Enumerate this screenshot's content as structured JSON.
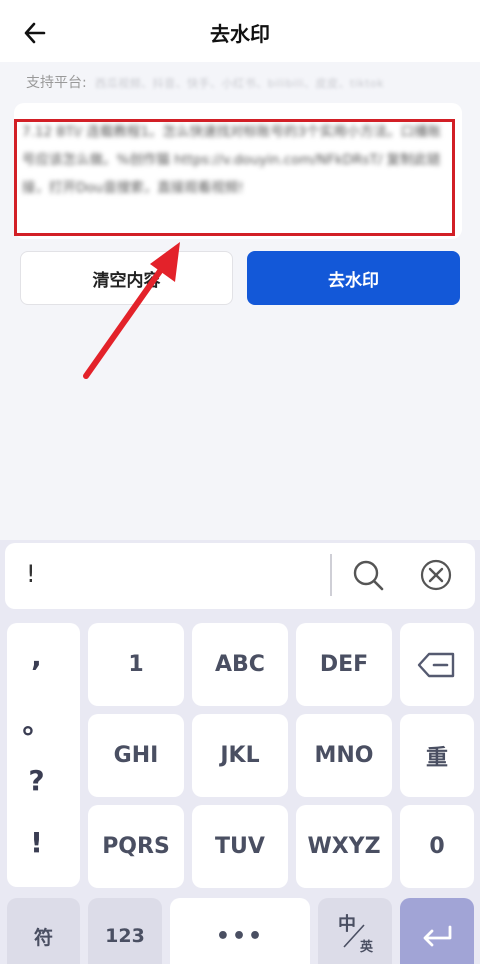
{
  "header": {
    "title": "去水印"
  },
  "platforms": {
    "label": "支持平台:",
    "list": "西瓜视频、抖音、快手、小红书、bilibili、皮皮、tiktok"
  },
  "input": {
    "text": "7.12 BTl/ 连载教程1。怎么快速找对标账号的3个实用小方法。口播账号应该怎么做。%创作猫 https://v.douyin.com/NFkDRsT/ 复制此链接，打开Dou音搜索，直接观看视频!"
  },
  "buttons": {
    "clear_label": "清空内容",
    "remove_label": "去水印"
  },
  "keyboard": {
    "input_text": "!",
    "punctuation": [
      ",",
      "。",
      "?",
      "!"
    ],
    "row1": [
      "1",
      "ABC",
      "DEF"
    ],
    "row2": [
      "GHI",
      "JKL",
      "MNO"
    ],
    "row3": [
      "PQRS",
      "TUV",
      "WXYZ"
    ],
    "row2_right": "重",
    "row3_right": "0",
    "symbols": "符",
    "numbers": "123",
    "space": "•••",
    "lang_zh": "中",
    "lang_en": "英"
  },
  "colors": {
    "accent": "#1358d8",
    "highlight": "#d21f26",
    "enter_key": "#a1a4d6"
  },
  "icons": [
    "back-arrow-icon",
    "search-icon",
    "clear-circle-icon",
    "backspace-icon",
    "enter-icon",
    "annotation-arrow"
  ]
}
